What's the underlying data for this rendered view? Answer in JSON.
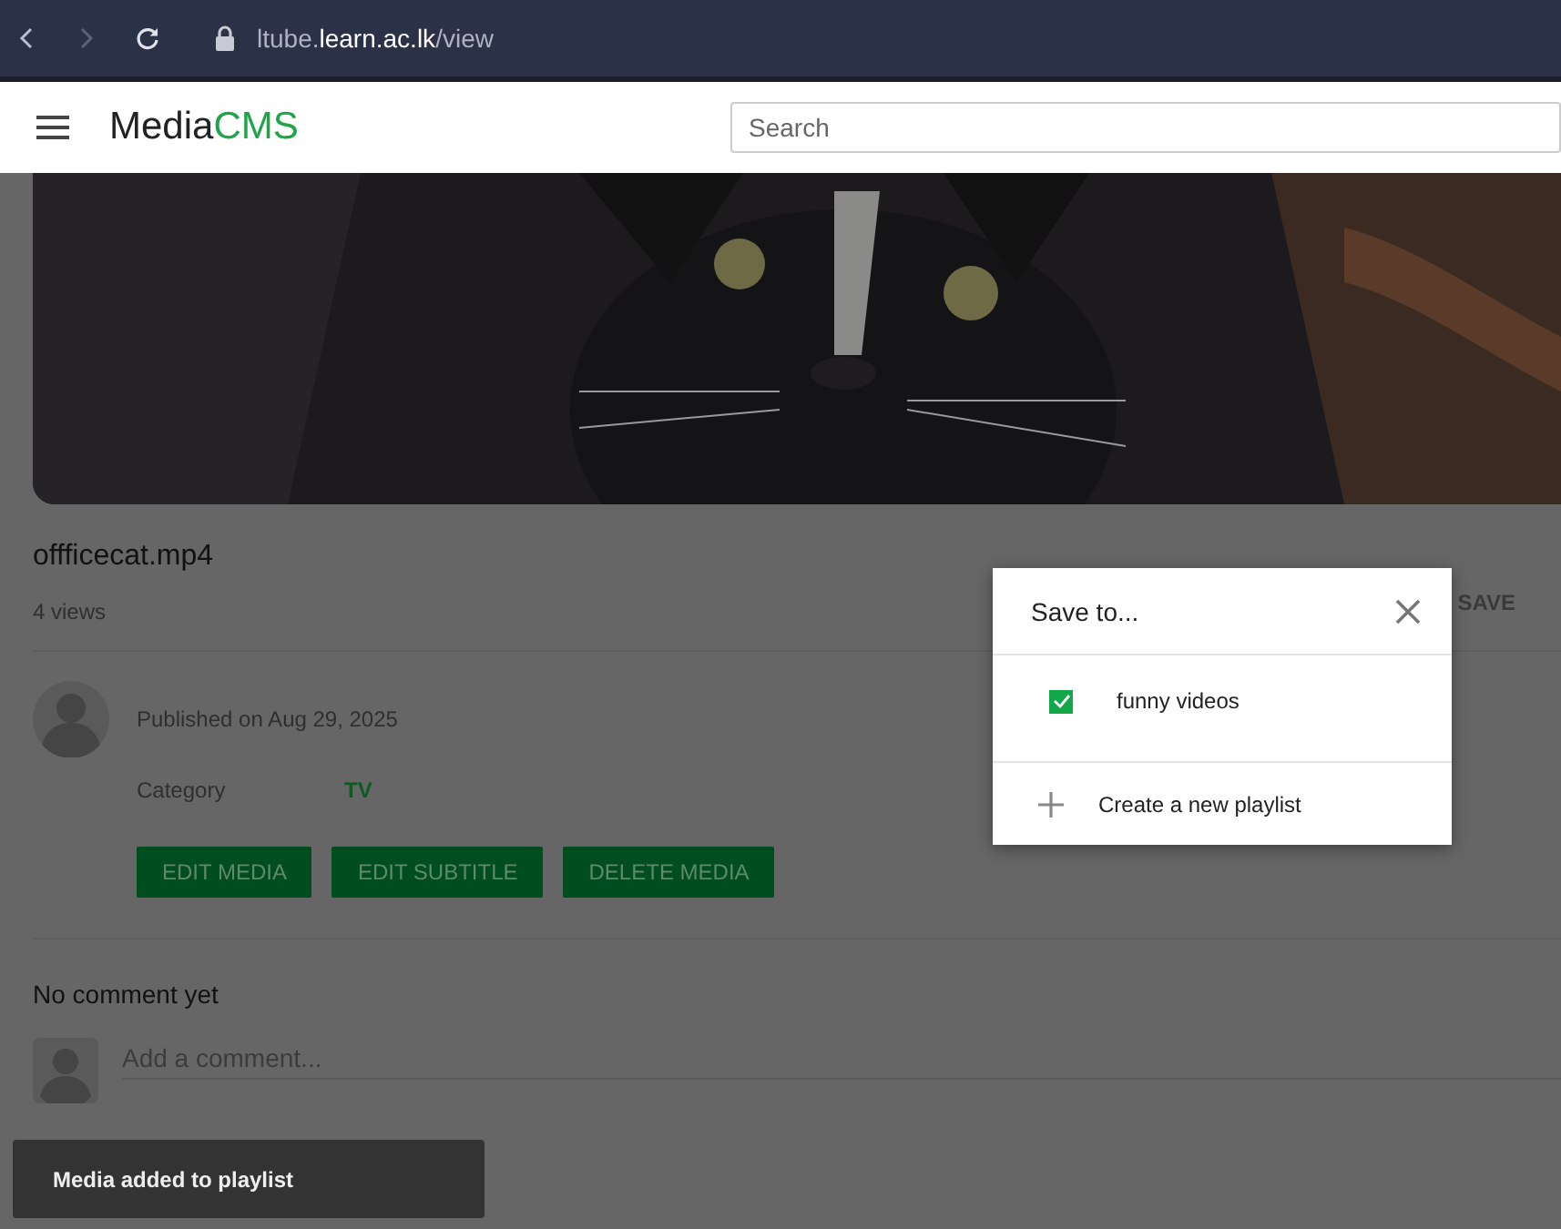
{
  "browser": {
    "url_prefix": "ltube.",
    "url_domain": "learn.ac.lk",
    "url_path": "/view"
  },
  "header": {
    "logo_left": "Media",
    "logo_right": "CMS",
    "search": {
      "placeholder": "Search"
    }
  },
  "media": {
    "title": "offficecat.mp4",
    "views": "4 views",
    "save": "SAVE",
    "published": "Published on Aug 29, 2025",
    "category_label": "Category",
    "category_value": "TV",
    "actions": [
      "EDIT MEDIA",
      "EDIT SUBTITLE",
      "DELETE MEDIA"
    ]
  },
  "comments": {
    "heading": "No comment yet",
    "input": {
      "placeholder": "Add a comment..."
    }
  },
  "dialog": {
    "title": "Save to...",
    "playlists": [
      {
        "name": "funny videos",
        "checked": true
      }
    ],
    "create": "Create a new playlist"
  },
  "toast": "Media added to playlist"
}
